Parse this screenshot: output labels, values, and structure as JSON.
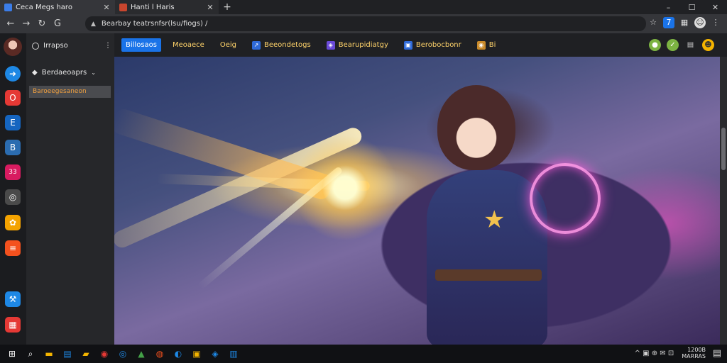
{
  "tabs": [
    {
      "title": "Ceca Megs haro",
      "active": true,
      "favicon_color": "#3b7de8"
    },
    {
      "title": "Hanti l Haris",
      "active": false,
      "favicon_color": "#c9462e"
    }
  ],
  "window_controls": {
    "minimize": "–",
    "maximize": "☐",
    "close": "✕"
  },
  "newtab_label": "+",
  "address": {
    "url": "Bearbay teatrsnfsr(lsu/fiogs) /",
    "lock_icon": "lock-icon"
  },
  "sidebar": {
    "profile_label": "Irrapso",
    "more_label": "⋮",
    "section_label": "Berdaeoaprs",
    "selected_item": "Baroeegesaneon"
  },
  "bookmarks": [
    {
      "label": "Billosaos",
      "icon_color": "#1a73e8"
    },
    {
      "label": "Meoaece",
      "icon_color": ""
    },
    {
      "label": "Oeig",
      "icon_color": ""
    },
    {
      "label": "Beeondetogs",
      "icon_color": "#2f6ad8"
    },
    {
      "label": "Bearupidiatgy",
      "icon_color": "#6a4ad8"
    },
    {
      "label": "Berobocbonr",
      "icon_color": "#2f6ad8"
    },
    {
      "label": "Bi",
      "icon_color": "#c98a2a"
    }
  ],
  "rail_icons": [
    {
      "name": "arrow-icon",
      "glyph": "➜",
      "color": "#1e88e5"
    },
    {
      "name": "office-icon",
      "glyph": "O",
      "color": "#e53935"
    },
    {
      "name": "edge-icon",
      "glyph": "E",
      "color": "#1565c0"
    },
    {
      "name": "store-icon",
      "glyph": "B",
      "color": "#2b6cb0"
    },
    {
      "name": "calendar-icon",
      "glyph": "33",
      "color": "#d81b60"
    },
    {
      "name": "chat-icon",
      "glyph": "◎",
      "color": "#4a4a4a"
    },
    {
      "name": "gear-icon",
      "glyph": "✿",
      "color": "#f4a300"
    },
    {
      "name": "notes-icon",
      "glyph": "≡",
      "color": "#f4511e"
    },
    {
      "name": "tools-icon",
      "glyph": "⚒",
      "color": "#1e88e5"
    },
    {
      "name": "photos-icon",
      "glyph": "▦",
      "color": "#e53935"
    }
  ],
  "tray": {
    "icons": "^ ▣ ⊕ ✉ ⊡",
    "time": "1200B",
    "date": "MARRAS"
  }
}
